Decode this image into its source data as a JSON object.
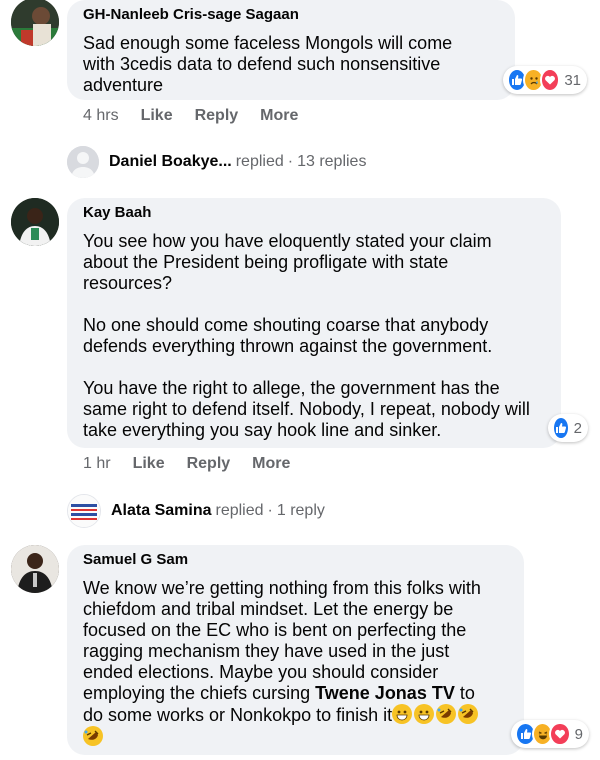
{
  "comments": [
    {
      "author": "GH-Nanleeb Cris-sage Sagaan",
      "text": "Sad enough some faceless Mongols will come\nwith 3cedis data to defend such nonsensitive\nadventure",
      "time": "4 hrs",
      "like": "Like",
      "reply": "Reply",
      "more": "More",
      "reaction_count": "31",
      "reactions": [
        "like-icon",
        "sad-icon",
        "love-icon"
      ]
    },
    {
      "author": "Kay Baah",
      "text": "You see how you have eloquently stated your claim\nabout the President being profligate with state\nresources?\n\nNo one should come shouting coarse that anybody\ndefends everything thrown against the government.\n\nYou have the right to allege, the government has the\nsame right to defend itself. Nobody, I repeat, nobody will\ntake everything you say hook line and sinker.",
      "time": "1 hr",
      "like": "Like",
      "reply": "Reply",
      "more": "More",
      "reaction_count": "2",
      "reactions": [
        "like-icon"
      ]
    },
    {
      "author": "Samuel G Sam",
      "text_before": "We know we’re getting nothing from this folks with\nchiefdom and tribal mindset. Let the energy be\nfocused on the EC who is bent on perfecting the\nragging mechanism they have used in the just\nended elections. Maybe you should consider\nemploying the chiefs cursing ",
      "mention": "Twene Jonas TV",
      "text_after": " to\ndo some works or Nonkokpo to finish it",
      "reaction_count": "9",
      "reactions": [
        "like-icon",
        "laugh-icon",
        "love-icon"
      ]
    }
  ],
  "replies": [
    {
      "name": "Daniel Boakye...",
      "verb": "replied",
      "sep": "·",
      "count": "13 replies"
    },
    {
      "name": "Alata Samina",
      "verb": "replied",
      "sep": "·",
      "count": "1 reply"
    }
  ],
  "colors": {
    "like_blue": "#1877f2",
    "love_red": "#f33e58",
    "haha_yellow": "#f7b125",
    "bubble_bg": "#f0f2f5",
    "meta_gray": "#65676b"
  }
}
